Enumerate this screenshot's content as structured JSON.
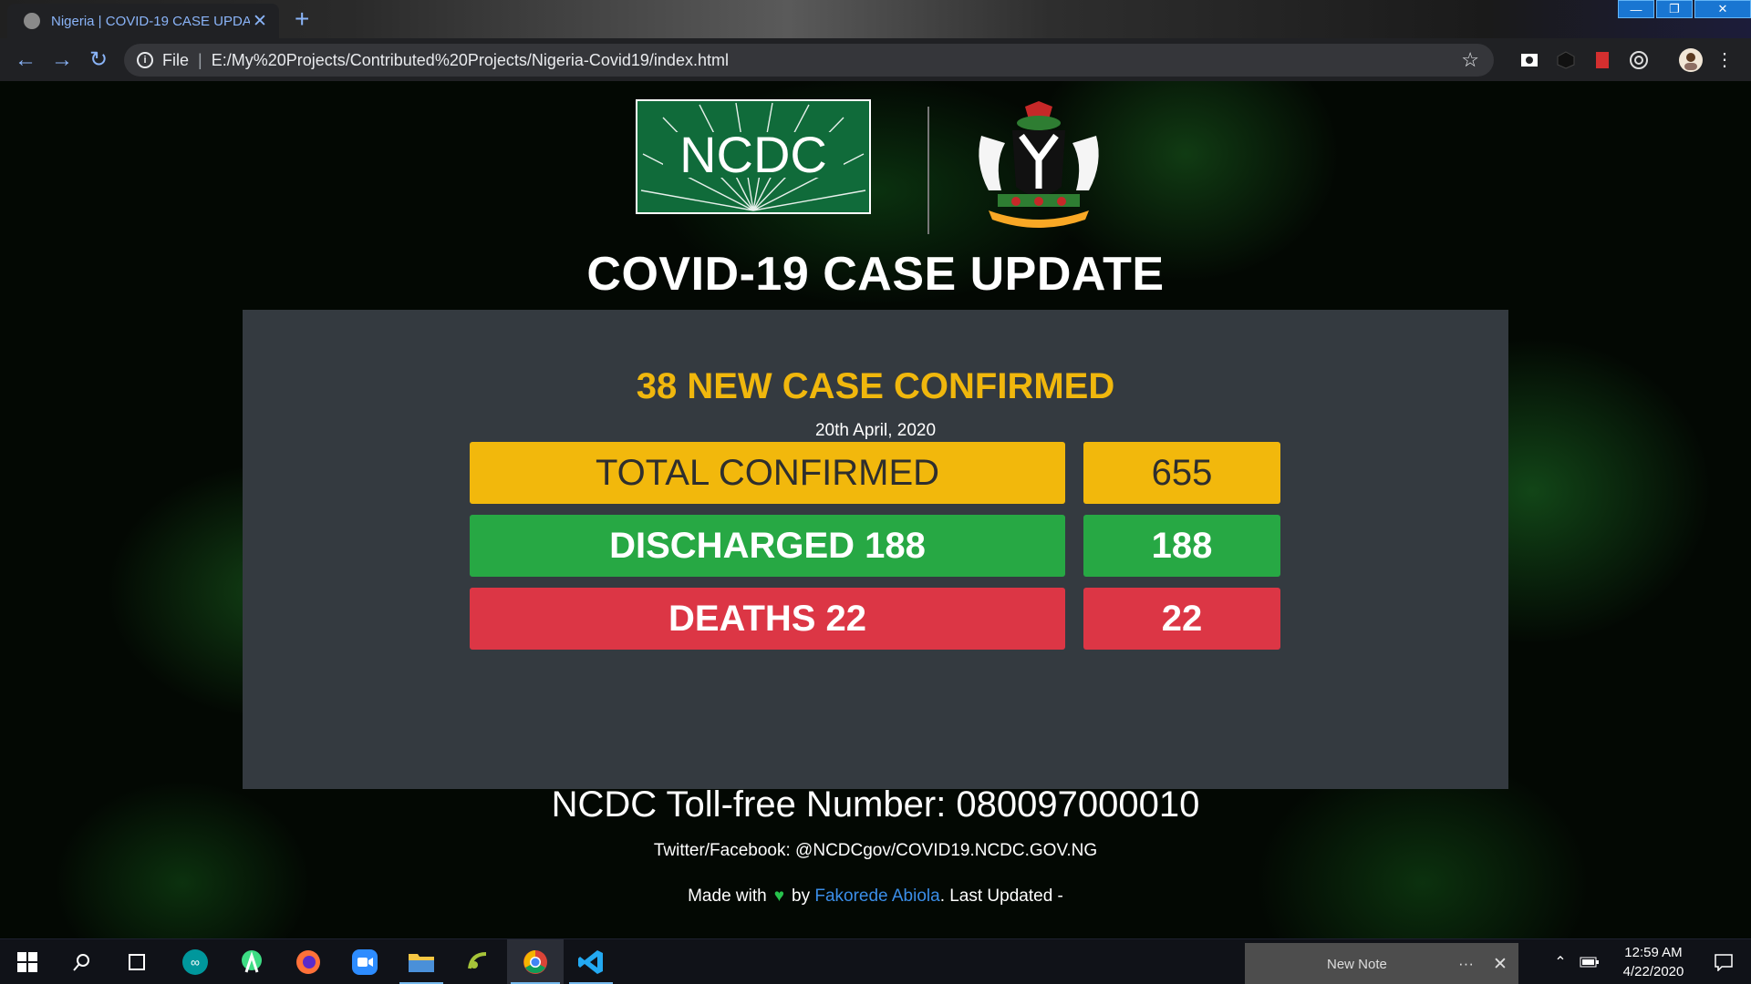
{
  "browser": {
    "tab_title": "Nigeria | COVID-19 CASE UPDATE",
    "tab_close": "✕",
    "new_tab": "+",
    "scheme_label": "File",
    "url": "E:/My%20Projects/Contributed%20Projects/Nigeria-Covid19/index.html"
  },
  "page": {
    "logo_text": "NCDC",
    "title": "COVID-19 CASE UPDATE",
    "headline": "38 NEW CASE CONFIRMED",
    "date": "20th April, 2020",
    "stats": [
      {
        "label": "TOTAL CONFIRMED",
        "value": "655",
        "color": "#f2b80c"
      },
      {
        "label": "DISCHARGED 188",
        "value": "188",
        "color": "#27a844"
      },
      {
        "label": "DEATHS 22",
        "value": "22",
        "color": "#dc3645"
      }
    ],
    "tollfree": "NCDC Toll-free Number: 080097000010",
    "social": "Twitter/Facebook: @NCDCgov/COVID19.NCDC.GOV.NG",
    "credit_prefix": "Made with",
    "credit_by": "by",
    "author": "Fakorede Abiola",
    "credit_suffix": ". Last Updated -"
  },
  "taskbar": {
    "sticky_note_title": "New Note",
    "sticky_note_more": "···",
    "sticky_note_close": "✕",
    "time": "12:59 AM",
    "date": "4/22/2020"
  },
  "colors": {
    "accent_yellow": "#f0b70d",
    "link_blue": "#3b8ee8",
    "panel": "#343a40"
  }
}
